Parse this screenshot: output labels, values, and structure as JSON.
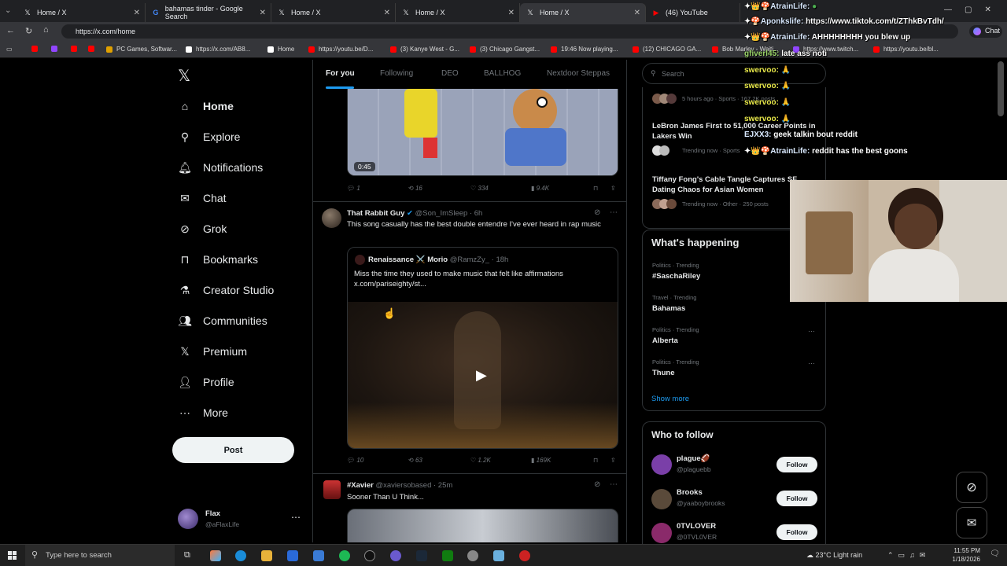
{
  "browser": {
    "tabs": [
      {
        "title": "Home / X",
        "icon": "x-icon",
        "active": false
      },
      {
        "title": "bahamas tinder - Google Search",
        "icon": "google-icon",
        "active": false
      },
      {
        "title": "Home / X",
        "icon": "x-icon",
        "active": false
      },
      {
        "title": "Home / X",
        "icon": "x-icon",
        "active": false
      },
      {
        "title": "Home / X",
        "icon": "x-icon",
        "active": true
      },
      {
        "title": "(46) YouTube",
        "icon": "youtube-icon",
        "active": false
      }
    ],
    "url": "https://x.com/home",
    "chat_button": "Chat",
    "bookmarks": [
      "PC Games, Softwar...",
      "https://x.com/AB8...",
      "Home",
      "https://youtu.be/D...",
      "(3) Kanye West - G...",
      "(3) Chicago Gangst...",
      "19:46 Now playing...",
      "(12) CHICAGO GA...",
      "Bob Marley - Waiti...",
      "https://www.twitch...",
      "https://youtu.be/bl..."
    ]
  },
  "nav": {
    "items": [
      {
        "label": "Home",
        "icon": "home-icon"
      },
      {
        "label": "Explore",
        "icon": "search-icon"
      },
      {
        "label": "Notifications",
        "icon": "bell-icon"
      },
      {
        "label": "Chat",
        "icon": "mail-icon"
      },
      {
        "label": "Grok",
        "icon": "grok-icon"
      },
      {
        "label": "Bookmarks",
        "icon": "bookmark-icon"
      },
      {
        "label": "Creator Studio",
        "icon": "flask-icon"
      },
      {
        "label": "Communities",
        "icon": "people-icon"
      },
      {
        "label": "Premium",
        "icon": "x-icon"
      },
      {
        "label": "Profile",
        "icon": "person-icon"
      },
      {
        "label": "More",
        "icon": "more-circle-icon"
      }
    ],
    "post_label": "Post",
    "account": {
      "name": "Flax",
      "handle": "@aFlaxLife"
    }
  },
  "feed": {
    "tabs": [
      "For you",
      "Following",
      "DEO",
      "BALLHOG",
      "Nextdoor Steppas"
    ],
    "tweet1": {
      "duration": "0:45",
      "replies": "1",
      "reposts": "16",
      "likes": "334",
      "views": "9.4K"
    },
    "tweet2": {
      "name": "That Rabbit Guy",
      "handle": "@Son_ImSleep",
      "time": "· 6h",
      "text": "This song casually has the best double entendre I've ever heard in rap music",
      "quote": {
        "name": "Renaissance ⚔️ Morio",
        "handle": "@RamzZy_",
        "time": "· 18h",
        "text": "Miss the time they used to make music that felt like affirmations",
        "link": "x.com/pariseighty/st..."
      },
      "replies": "10",
      "reposts": "63",
      "likes": "1.2K",
      "views": "169K"
    },
    "tweet3": {
      "name": "#Xavier",
      "handle": "@xaviersobased",
      "time": "· 25m",
      "text": "Sooner Than U Think..."
    }
  },
  "right": {
    "search_placeholder": "Search",
    "news": [
      {
        "meta": "5 hours ago · Sports · 167.2K posts",
        "title": ""
      },
      {
        "title": "LeBron James First to 51,000 Career Points in Lakers Win",
        "meta": "Trending now · Sports"
      },
      {
        "title": "Tiffany Fong's Cable Tangle Captures SF Dating Chaos for Asian Women",
        "meta": "Trending now · Other · 250 posts"
      }
    ],
    "happening_title": "What's happening",
    "trends": [
      {
        "meta": "Politics · Trending",
        "title": "#SaschaRiley"
      },
      {
        "meta": "Travel · Trending",
        "title": "Bahamas"
      },
      {
        "meta": "Politics · Trending",
        "title": "Alberta"
      },
      {
        "meta": "Politics · Trending",
        "title": "Thune"
      }
    ],
    "show_more": "Show more",
    "wtf_title": "Who to follow",
    "follows": [
      {
        "name": "plague🏈",
        "handle": "@plaguebb",
        "color": "#7a3fa8"
      },
      {
        "name": "Brooks",
        "handle": "@yaaboybrooks",
        "color": "#5a4a3a"
      },
      {
        "name": "0TVLOVER",
        "handle": "@0TVL0VER",
        "color": "#8a2a6a"
      }
    ],
    "follow_label": "Follow"
  },
  "overlay": {
    "chat": [
      {
        "user": "AtrainLife:",
        "msg": ""
      },
      {
        "user": "Aponkslife:",
        "msg": "https://www.tiktok.com/t/ZThkBvTdh/"
      },
      {
        "user": "AtrainLife:",
        "msg": "AHHHHHHHH you blew up"
      },
      {
        "user": "gfiverl45:",
        "msg": "late ass noti"
      },
      {
        "user": "swervoo:",
        "msg": "🙏"
      },
      {
        "user": "swervoo:",
        "msg": "🙏"
      },
      {
        "user": "swervoo:",
        "msg": "🙏"
      },
      {
        "user": "swervoo:",
        "msg": "🙏"
      },
      {
        "user": "EJXX3:",
        "msg": "geek talkin bout reddit"
      },
      {
        "user": "AtrainLife:",
        "msg": "reddit has the best goons"
      }
    ]
  },
  "taskbar": {
    "search_placeholder": "Type here to search",
    "weather": "23°C  Light rain",
    "time": "11:55 PM",
    "date": "1/18/2026"
  }
}
